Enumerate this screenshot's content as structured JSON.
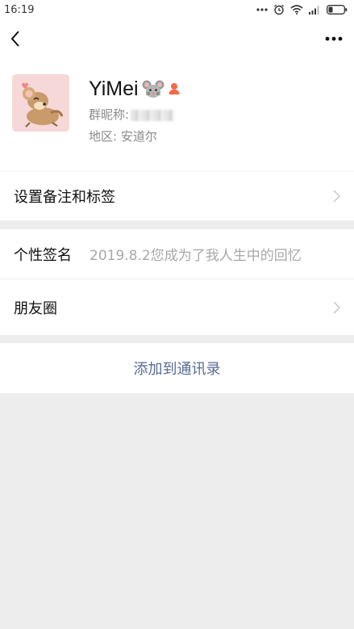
{
  "status_bar": {
    "time": "16:19",
    "icons": [
      "more-dots-icon",
      "alarm-icon",
      "wifi-icon",
      "signal-icon",
      "battery-icon"
    ]
  },
  "nav": {
    "back_icon": "back-arrow-icon",
    "more_icon": "more-options-icon"
  },
  "profile": {
    "name": "YiMei",
    "name_emoji": "mouse-face",
    "badge_icon": "friend-badge-icon",
    "group_nickname_label": "群昵称:",
    "region_label": "地区:",
    "region_value": "安道尔"
  },
  "menu": {
    "remark_tags": "设置备注和标签",
    "signature_label": "个性签名",
    "signature_value": "2019.8.2您成为了我人生中的回忆",
    "moments": "朋友圈"
  },
  "actions": {
    "add_contact": "添加到通讯录"
  },
  "colors": {
    "link_blue": "#576b95",
    "badge_orange": "#f06a4a",
    "background": "#ededed"
  }
}
